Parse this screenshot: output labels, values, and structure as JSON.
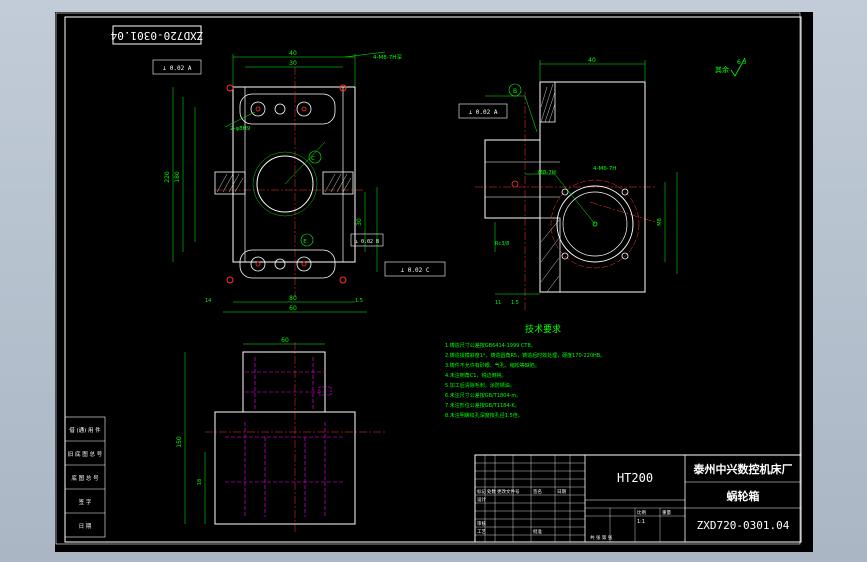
{
  "drawing": {
    "number_stamp": "ZXD720-0301.04",
    "drawing_number": "ZXD720-0301.04",
    "material": "HT200",
    "company": "泰州中兴数控机床厂",
    "part_name": "蜗轮箱",
    "roughness_symbol": "其余",
    "roughness_value": "6.3"
  },
  "tech_req": {
    "title": "技术要求",
    "lines": [
      "1.铸造尺寸公差按GB6414-1999 CT8。",
      "2.铸造拔模斜度1°，铸造圆角R5，铸造后时效处理，硬度170-220HB。",
      "3.铸件不允许有砂眼、气孔、缩松等缺陷。",
      "4.未注倒角C1，锐边倒钝。",
      "5.加工后清除毛刺，涂防锈油。",
      "6.未注尺寸公差按GB/T1804-m。",
      "7.未注形位公差按GB/T1184-K。",
      "8.未注明螺纹孔深度按孔径1.5倍。"
    ]
  },
  "callouts": {
    "holes_top": "4-M8-7H深",
    "holes_left": "2-φ8H9",
    "holes_right": "4-M6-7H",
    "tap_label": "M8-7H",
    "datum_b": "B",
    "datum_c": "C",
    "datum_e": "E"
  },
  "tolerances": {
    "frame1": "⊥ 0.02 A",
    "frame2": "⊥ 0.02 A",
    "frame3": "⊥ 0.02 C",
    "frame4": "⊥ 0.02 B"
  },
  "dimensions": {
    "front": [
      "40",
      "30",
      "220",
      "180",
      "80",
      "60",
      "30",
      "14",
      "1.5"
    ],
    "side": [
      "40",
      "M8",
      "Rc3/8",
      "11",
      "1.5"
    ],
    "bottom": [
      "150",
      "60",
      "18"
    ]
  },
  "title_block": {
    "row_labels": [
      "标记",
      "处数",
      "更改文件号",
      "签名",
      "日期"
    ],
    "design": "设计",
    "check": "审核",
    "process": "工艺",
    "approve": "批准",
    "scale_label": "比例",
    "scale_value": "1:1",
    "weight_label": "重量",
    "sheet_label": "共 张 第 张"
  },
  "left_strip": [
    "借 (通) 用 件",
    "旧 底 图 总 号",
    "底 图 总 号",
    "签 字",
    "日 期"
  ]
}
